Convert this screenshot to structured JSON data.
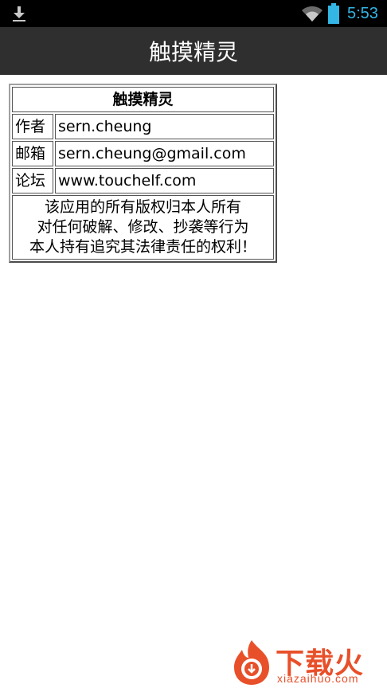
{
  "status_bar": {
    "time": "5:53",
    "icons": [
      "download-icon",
      "wifi-icon",
      "battery-icon"
    ],
    "accent_color": "#33b5e5"
  },
  "action_bar": {
    "title": "触摸精灵",
    "background": "#2f2f2f"
  },
  "info_table": {
    "title": "触摸精灵",
    "rows": [
      {
        "key": "作者",
        "value": "sern.cheung"
      },
      {
        "key": "邮箱",
        "value": "sern.cheung@gmail.com"
      },
      {
        "key": "论坛",
        "value": "www.touchelf.com"
      }
    ],
    "notice": [
      "该应用的所有版权归本人所有",
      "对任何破解、修改、抄袭等行为",
      "本人持有追究其法律责任的权利！"
    ]
  },
  "watermark": {
    "text": "下载火",
    "domain": "xiazaihuo.com",
    "color": "#e8502a"
  }
}
